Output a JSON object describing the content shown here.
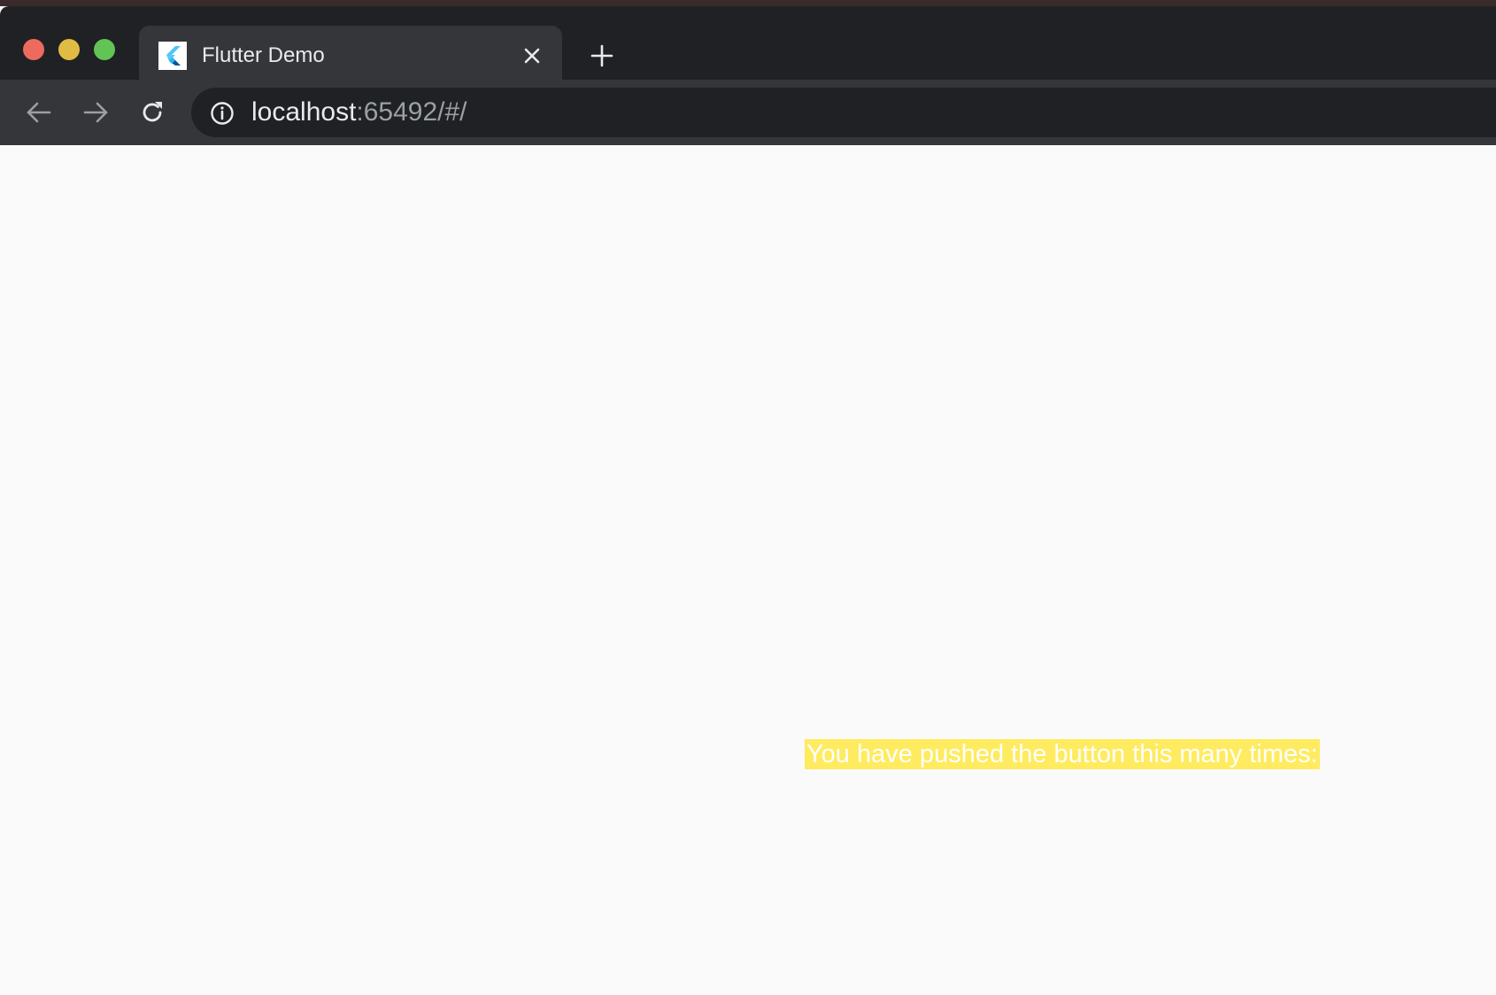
{
  "browser": {
    "tab": {
      "title": "Flutter Demo",
      "favicon": "flutter-logo-icon"
    },
    "url": {
      "host": "localhost",
      "rest": ":65492/#/"
    },
    "icons": {
      "back": "arrow-left-icon",
      "forward": "arrow-right-icon",
      "reload": "reload-icon",
      "info": "info-icon",
      "close": "close-icon",
      "new_tab": "plus-icon"
    }
  },
  "page": {
    "counter_label": "You have pushed the button this many times:",
    "highlight_color": "#ffeb5f"
  },
  "colors": {
    "traffic_red": "#ed6a5e",
    "traffic_yellow": "#e0bc45",
    "traffic_green": "#61c454"
  }
}
